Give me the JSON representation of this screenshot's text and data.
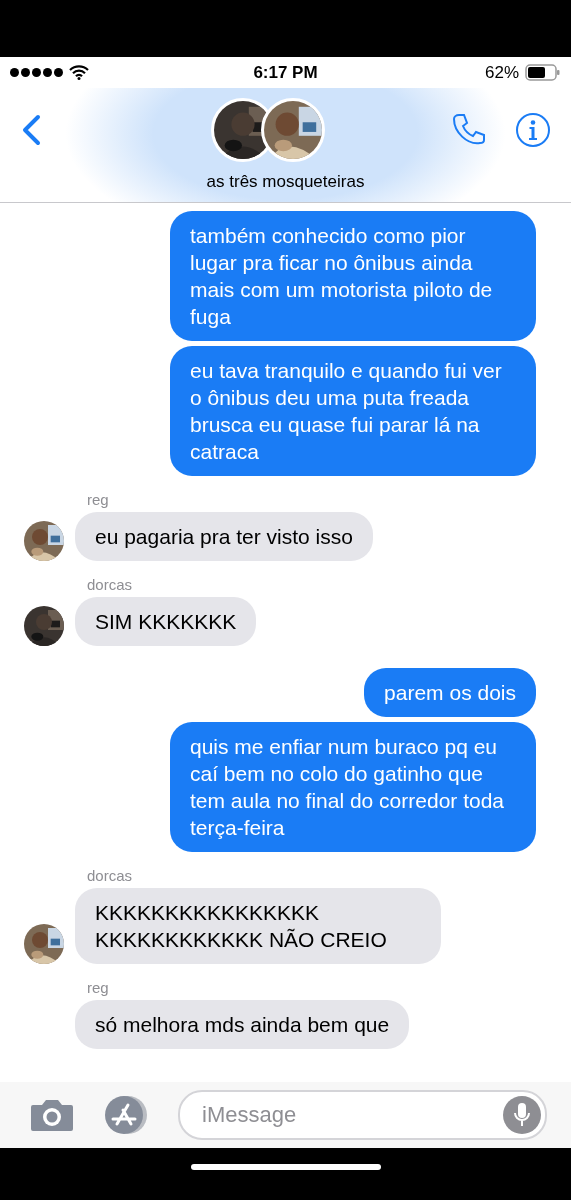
{
  "status_bar": {
    "time": "6:17 PM",
    "battery": "62%"
  },
  "header": {
    "title": "as três mosqueteiras"
  },
  "messages": [
    {
      "kind": "sent",
      "text": "também conhecido como pior lugar pra ficar no ônibus ainda mais com um motorista piloto de fuga"
    },
    {
      "kind": "sent",
      "text": "eu tava tranquilo e quando fui ver o ônibus deu uma puta freada brusca eu quase fui parar lá na catraca"
    },
    {
      "kind": "received",
      "sender": "reg",
      "text": "eu pagaria pra ter visto isso"
    },
    {
      "kind": "received",
      "sender": "dorcas",
      "text": "SIM KKKKKKK"
    },
    {
      "kind": "sent",
      "text": "parem os dois"
    },
    {
      "kind": "sent",
      "text": "quis me enfiar num buraco pq eu caí bem no colo do gatinho que tem aula no final do corredor toda terça-feira"
    },
    {
      "kind": "received",
      "sender": "dorcas",
      "text": "KKKKKKKKKKKKKKKK KKKKKKKKKKKK NÃO CREIO"
    },
    {
      "kind": "received",
      "sender": "reg",
      "text": "só melhora mds ainda bem que"
    }
  ],
  "composer": {
    "placeholder": "iMessage"
  }
}
